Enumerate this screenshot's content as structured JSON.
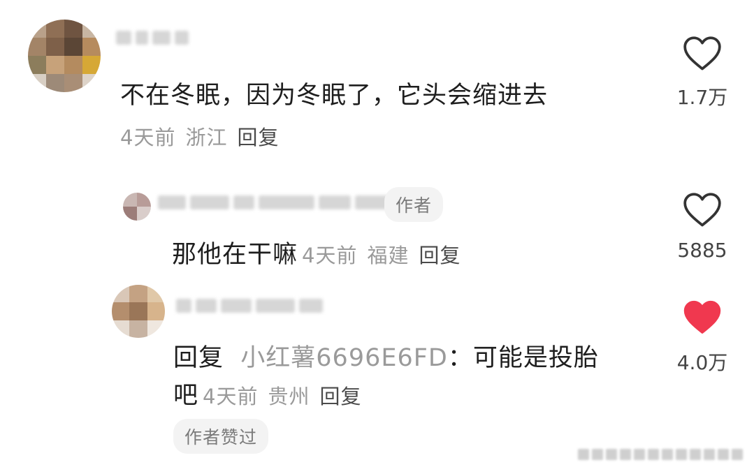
{
  "comments": [
    {
      "text": "不在冬眠，因为冬眠了，它头会缩进去",
      "time": "4天前",
      "location": "浙江",
      "reply_label": "回复",
      "like_count": "1.7万",
      "liked": false
    },
    {
      "author_tag": "作者",
      "text": "那他在干嘛",
      "time": "4天前",
      "location": "福建",
      "reply_label": "回复",
      "like_count": "5885",
      "liked": false
    },
    {
      "text_prefix": "回复",
      "mentioned_user": "小红薯6696E6FD",
      "text_body_line1": "：可能是投胎",
      "text_body_line2": "吧",
      "time": "4天前",
      "location": "贵州",
      "reply_label": "回复",
      "like_count": "4.0万",
      "liked": true,
      "author_liked_label": "作者赞过"
    }
  ],
  "colors": {
    "liked_heart": "#f0384f",
    "heart_outline": "#333333",
    "meta_text": "#9a9a9a"
  },
  "icons": [
    "heart-outline-icon",
    "heart-filled-icon"
  ]
}
